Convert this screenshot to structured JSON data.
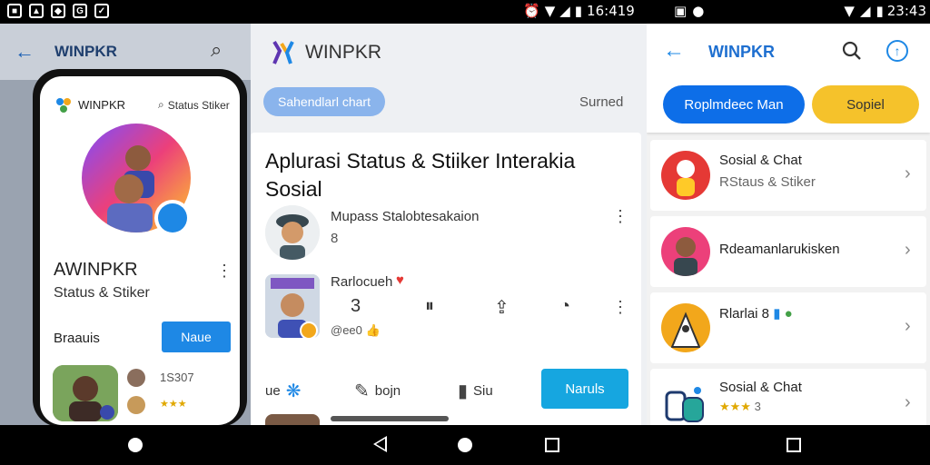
{
  "status_bar": {
    "left_icons": [
      "sim-icon",
      "image-icon",
      "file-icon",
      "save-icon",
      "tool-icon"
    ],
    "mid_time": "16:419",
    "right_time": "23:43"
  },
  "left_app": {
    "header_title": "WINPKR",
    "phone": {
      "brand": "WINPKR",
      "search_label": "Status Stiker",
      "name": "AWINPKR",
      "subtitle": "Status & Stiker",
      "row_label": "Braauis",
      "button_label": "Naue",
      "count": "1S307"
    }
  },
  "middle_app": {
    "brand": "WINPKR",
    "pill_label": "Sahendlarl chart",
    "right_label": "Surned",
    "card": {
      "title": "Aplurasi Status & Stiiker  Interakia Sosial",
      "post1_name": "Mupass Stalobtesakaion",
      "post1_num": "8",
      "post2_name": "Rarlocueh",
      "post2_tag": "@ee0",
      "icon_num": "3",
      "actions": [
        {
          "label": "ue",
          "icon": "butterfly-icon"
        },
        {
          "label": "bojn",
          "icon": "edit-icon"
        },
        {
          "label": "Siu",
          "icon": "like-icon"
        }
      ],
      "cta_label": "Naruls"
    }
  },
  "right_app": {
    "title": "WINPKR",
    "btn_primary": "Roplmdeec Man",
    "btn_secondary": "Sopiel",
    "items": [
      {
        "title": "Sosial & Chat",
        "subtitle": "RStaus & Stiker"
      },
      {
        "title": "Rdeamanlarukisken",
        "subtitle": ""
      },
      {
        "title": "Rlarlai 8",
        "subtitle": ""
      },
      {
        "title": "Sosial & Chat",
        "subtitle": "3"
      }
    ]
  },
  "colors": {
    "primary_blue": "#1e88e5",
    "cta_cyan": "#16a6e0",
    "accent_yellow": "#f5c22b"
  }
}
